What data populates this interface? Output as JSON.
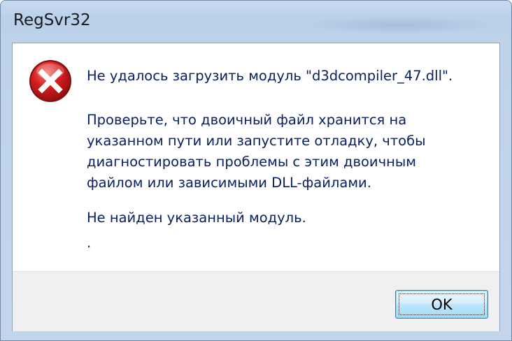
{
  "window": {
    "title": "RegSvr32"
  },
  "dialog": {
    "icon": "error-icon",
    "message_line1": "Не удалось загрузить модуль \"d3dcompiler_47.dll\".",
    "message_paragraph": [
      "Проверьте, что двоичный файл хранится на",
      "указанном пути или запустите отладку, чтобы",
      "диагностировать проблемы с этим двоичным",
      "файлом или зависимыми DLL-файлами."
    ],
    "error_detail": "Не найден указанный модуль.",
    "trailing_text": "."
  },
  "buttons": {
    "ok_label": "OK"
  },
  "colors": {
    "message_text": "#0a2060",
    "icon_red": "#c8102e",
    "button_border": "#3c7fb1"
  }
}
